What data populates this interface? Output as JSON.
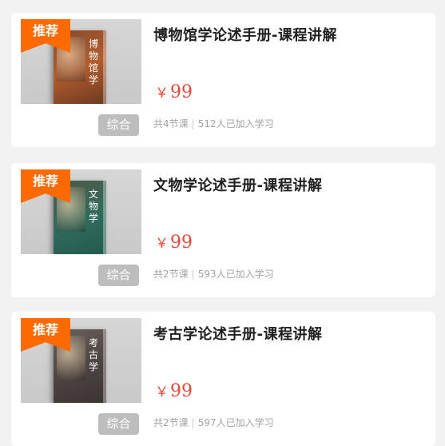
{
  "courses": [
    {
      "badge": "推荐",
      "cover_title": "博物馆学",
      "title": "博物馆学论述手册-课程讲解",
      "currency": "￥",
      "price": "99",
      "category": "综合",
      "lessons": "共4节课",
      "learners": "512人已加入学习"
    },
    {
      "badge": "推荐",
      "cover_title": "文物学",
      "title": "文物学论述手册-课程讲解",
      "currency": "￥",
      "price": "99",
      "category": "综合",
      "lessons": "共2节课",
      "learners": "593人已加入学习"
    },
    {
      "badge": "推荐",
      "cover_title": "考古学",
      "title": "考古学论述手册-课程讲解",
      "currency": "￥",
      "price": "99",
      "category": "综合",
      "lessons": "共2节课",
      "learners": "597人已加入学习"
    }
  ],
  "meta_separator": "|",
  "colors": {
    "badge_bg": "#ff6a00",
    "price": "#e24a3b",
    "tag_bg": "#bdbdbd",
    "page_bg": "#f2f2f2"
  }
}
